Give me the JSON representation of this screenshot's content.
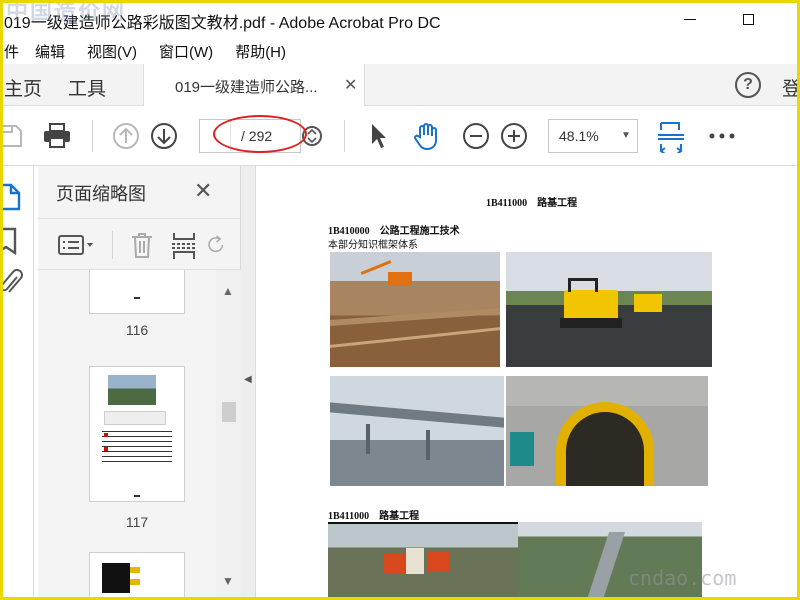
{
  "window": {
    "title": "019一级建造师公路彩版图文教材.pdf - Adobe Acrobat Pro DC",
    "minimize": "—",
    "maximize": "☐"
  },
  "menu": [
    "件",
    "编辑",
    "视图(V)",
    "窗口(W)",
    "帮助(H)"
  ],
  "tabs": {
    "home": "主页",
    "tools": "工具",
    "document": "019一级建造师公路...",
    "close": "✕",
    "help": "?",
    "login": "登"
  },
  "toolbar": {
    "page_current": "",
    "page_total": "/ 292",
    "zoom": "48.1%"
  },
  "thumbnails": {
    "title": "页面缩略图",
    "close": "✕",
    "pages": [
      {
        "number": "116"
      },
      {
        "number": "117"
      },
      {
        "number": ""
      }
    ]
  },
  "document": {
    "heading": "1B411000　路基工程",
    "section_title": "1B410000　公路工程施工技术",
    "section_sub": "本部分知识框架体系",
    "section2_title": "1B411000　路基工程"
  },
  "watermarks": {
    "top_left": "中国造价网",
    "bottom_right": "cndao.com"
  }
}
